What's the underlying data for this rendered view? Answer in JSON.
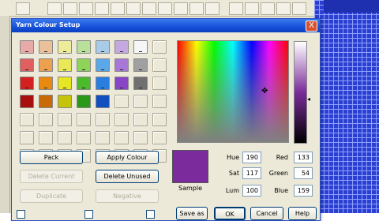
{
  "dialog": {
    "title": "Yarn Colour Setup",
    "close_glyph": "X"
  },
  "swatches": [
    [
      "#e8a9a9",
      "#e9c09a",
      "#ecec9a",
      "#b8e09a",
      "#a8cbe8",
      "#c6a8e0",
      "#f6f6f6",
      "empty"
    ],
    [
      "#e06060",
      "#eca050",
      "#e8e858",
      "#8ed458",
      "#5aa8e8",
      "#a878d8",
      "#a0a0a0",
      "empty"
    ],
    [
      "#d42020",
      "#e88a10",
      "#e6e622",
      "#4cba2a",
      "#2a7ee0",
      "#8a44c8",
      "#707070",
      "empty"
    ],
    [
      "#a81010",
      "#c86a08",
      "#c4c40a",
      "#2a9818",
      "#1250c0",
      "empty",
      "empty",
      "empty"
    ],
    [
      "empty",
      "empty",
      "empty",
      "empty",
      "empty",
      "empty",
      "empty",
      "empty"
    ],
    [
      "empty",
      "empty",
      "empty",
      "empty",
      "empty",
      "empty",
      "empty",
      "empty"
    ],
    [
      "empty",
      "empty",
      "empty",
      "empty",
      "empty",
      "empty",
      "empty",
      "empty"
    ]
  ],
  "buttons": {
    "pack": "Pack",
    "apply_colour": "Apply Colour",
    "delete_current": "Delete Current",
    "delete_unused": "Delete Unused",
    "duplicate": "Duplicate",
    "negative": "Negative",
    "save_as": "Save as",
    "ok": "OK",
    "cancel": "Cancel",
    "help": "Help"
  },
  "sample": {
    "label": "Sample",
    "color": "#7c2b9c"
  },
  "fields": {
    "hue_label": "Hue",
    "hue": "190",
    "sat_label": "Sat",
    "sat": "117",
    "lum_label": "Lum",
    "lum": "100",
    "red_label": "Red",
    "red": "133",
    "green_label": "Green",
    "green": "54",
    "blue_label": "Blue",
    "blue": "159"
  }
}
